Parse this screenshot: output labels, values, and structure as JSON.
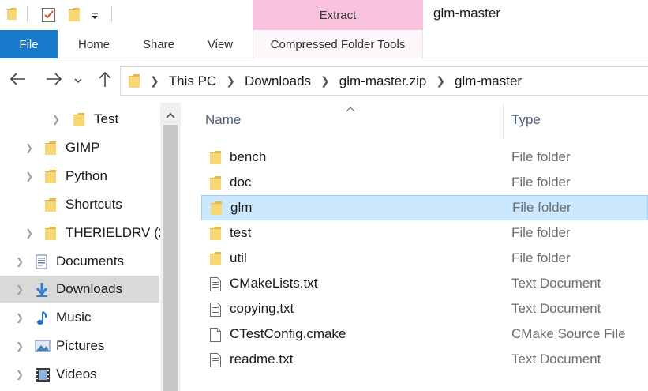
{
  "title_bar": {
    "contextual_tab_group": "Extract",
    "window_title": "glm-master",
    "quick_access_icons": [
      "folder-icon",
      "properties-checkmark-icon",
      "new-folder-icon",
      "customize-dropdown-icon"
    ]
  },
  "ribbon": {
    "tabs": [
      "File",
      "Home",
      "Share",
      "View",
      "Compressed Folder Tools"
    ],
    "file_color": "#1979ca",
    "context_color": "#f9c3dd"
  },
  "nav": {
    "back_icon": "arrow-left-icon",
    "forward_icon": "arrow-right-icon",
    "recent_icon": "chevron-down-icon",
    "up_icon": "arrow-up-icon",
    "breadcrumb": [
      "This PC",
      "Downloads",
      "glm-master.zip",
      "glm-master"
    ]
  },
  "navpane": {
    "items": [
      {
        "label": "Test",
        "icon": "folder-icon"
      },
      {
        "label": "GIMP",
        "icon": "folder-icon"
      },
      {
        "label": "Python",
        "icon": "folder-icon"
      },
      {
        "label": "Shortcuts",
        "icon": "folder-icon"
      },
      {
        "label": "THERIELDRV (2",
        "icon": "folder-icon"
      },
      {
        "label": "Documents",
        "icon": "documents-icon"
      },
      {
        "label": "Downloads",
        "icon": "download-arrow-icon",
        "selected": true
      },
      {
        "label": "Music",
        "icon": "music-note-icon"
      },
      {
        "label": "Pictures",
        "icon": "pictures-icon"
      },
      {
        "label": "Videos",
        "icon": "film-strip-icon"
      }
    ]
  },
  "filelist": {
    "columns": [
      "Name",
      "Type"
    ],
    "rows": [
      {
        "name": "bench",
        "type": "File folder",
        "icon": "folder-icon"
      },
      {
        "name": "doc",
        "type": "File folder",
        "icon": "folder-icon"
      },
      {
        "name": "glm",
        "type": "File folder",
        "icon": "folder-icon",
        "selected": true
      },
      {
        "name": "test",
        "type": "File folder",
        "icon": "folder-icon"
      },
      {
        "name": "util",
        "type": "File folder",
        "icon": "folder-icon"
      },
      {
        "name": "CMakeLists.txt",
        "type": "Text Document",
        "icon": "text-file-icon"
      },
      {
        "name": "copying.txt",
        "type": "Text Document",
        "icon": "text-file-icon"
      },
      {
        "name": "CTestConfig.cmake",
        "type": "CMake Source File",
        "icon": "generic-file-icon"
      },
      {
        "name": "readme.txt",
        "type": "Text Document",
        "icon": "text-file-icon"
      }
    ],
    "selected_color": "#cce8ff"
  }
}
